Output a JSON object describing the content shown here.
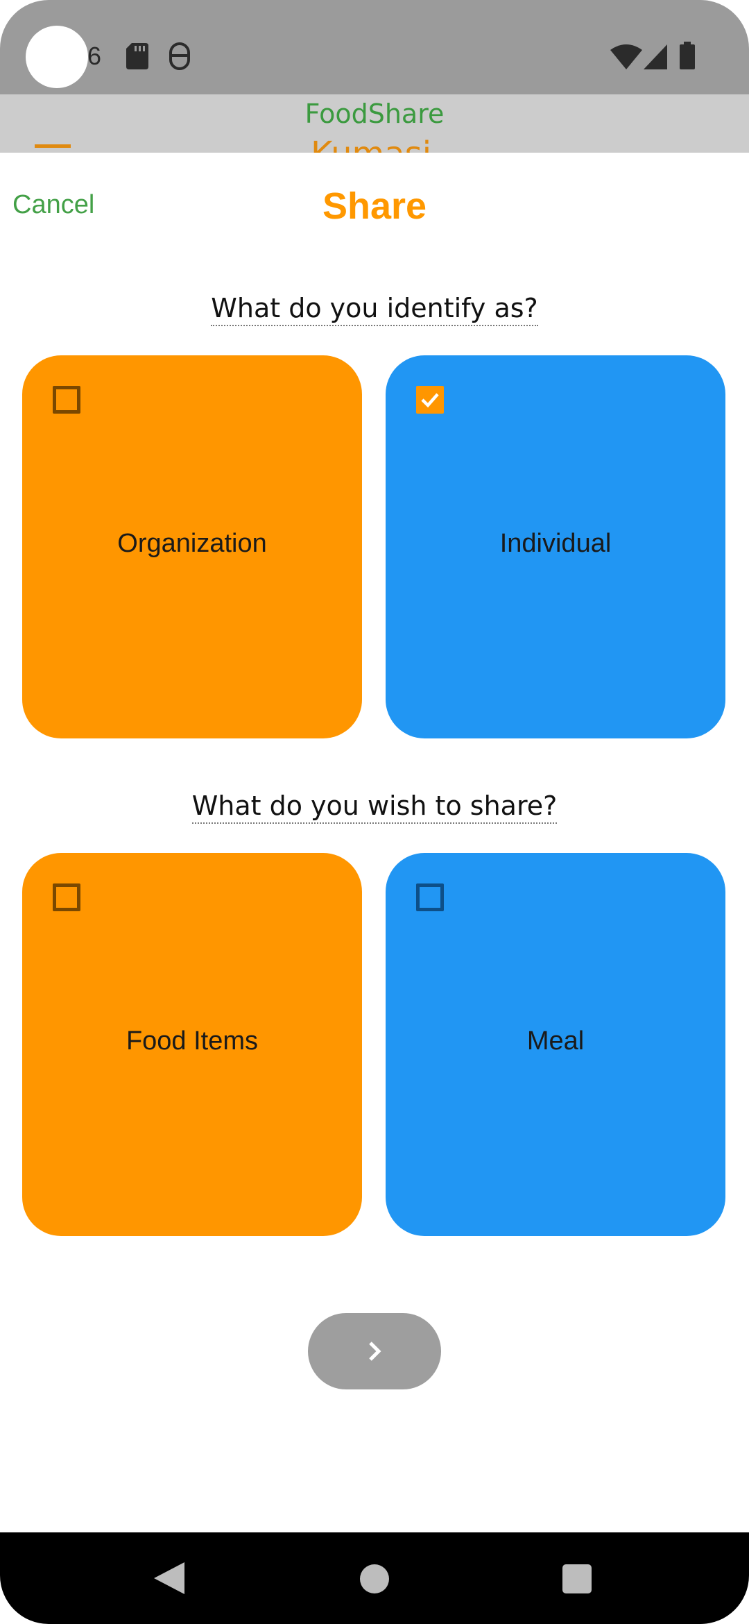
{
  "status_bar": {
    "time_fragment": "6",
    "icons": [
      "sd-card-icon",
      "assistant-icon",
      "wifi-icon",
      "signal-icon",
      "battery-icon"
    ]
  },
  "header": {
    "app_title": "FoodShare",
    "city_partial": "Kumasi"
  },
  "sheet": {
    "cancel_label": "Cancel",
    "title": "Share",
    "question_identity": "What do you identify as?",
    "identity_options": [
      {
        "label": "Organization",
        "checked": false,
        "color": "#ff9600"
      },
      {
        "label": "Individual",
        "checked": true,
        "color": "#2196f3"
      }
    ],
    "question_share": "What do you wish to share?",
    "share_options": [
      {
        "label": "Food Items",
        "checked": false,
        "color": "#ff9600"
      },
      {
        "label": "Meal",
        "checked": false,
        "color": "#2196f3"
      }
    ],
    "next_icon": "chevron-right-icon"
  },
  "colors": {
    "accent_orange": "#ff9800",
    "accent_blue": "#2196f3",
    "cancel_green": "#43a047",
    "disabled_gray": "#9e9e9e"
  },
  "nav": {
    "icons": [
      "back-icon",
      "home-icon",
      "recents-icon"
    ]
  }
}
